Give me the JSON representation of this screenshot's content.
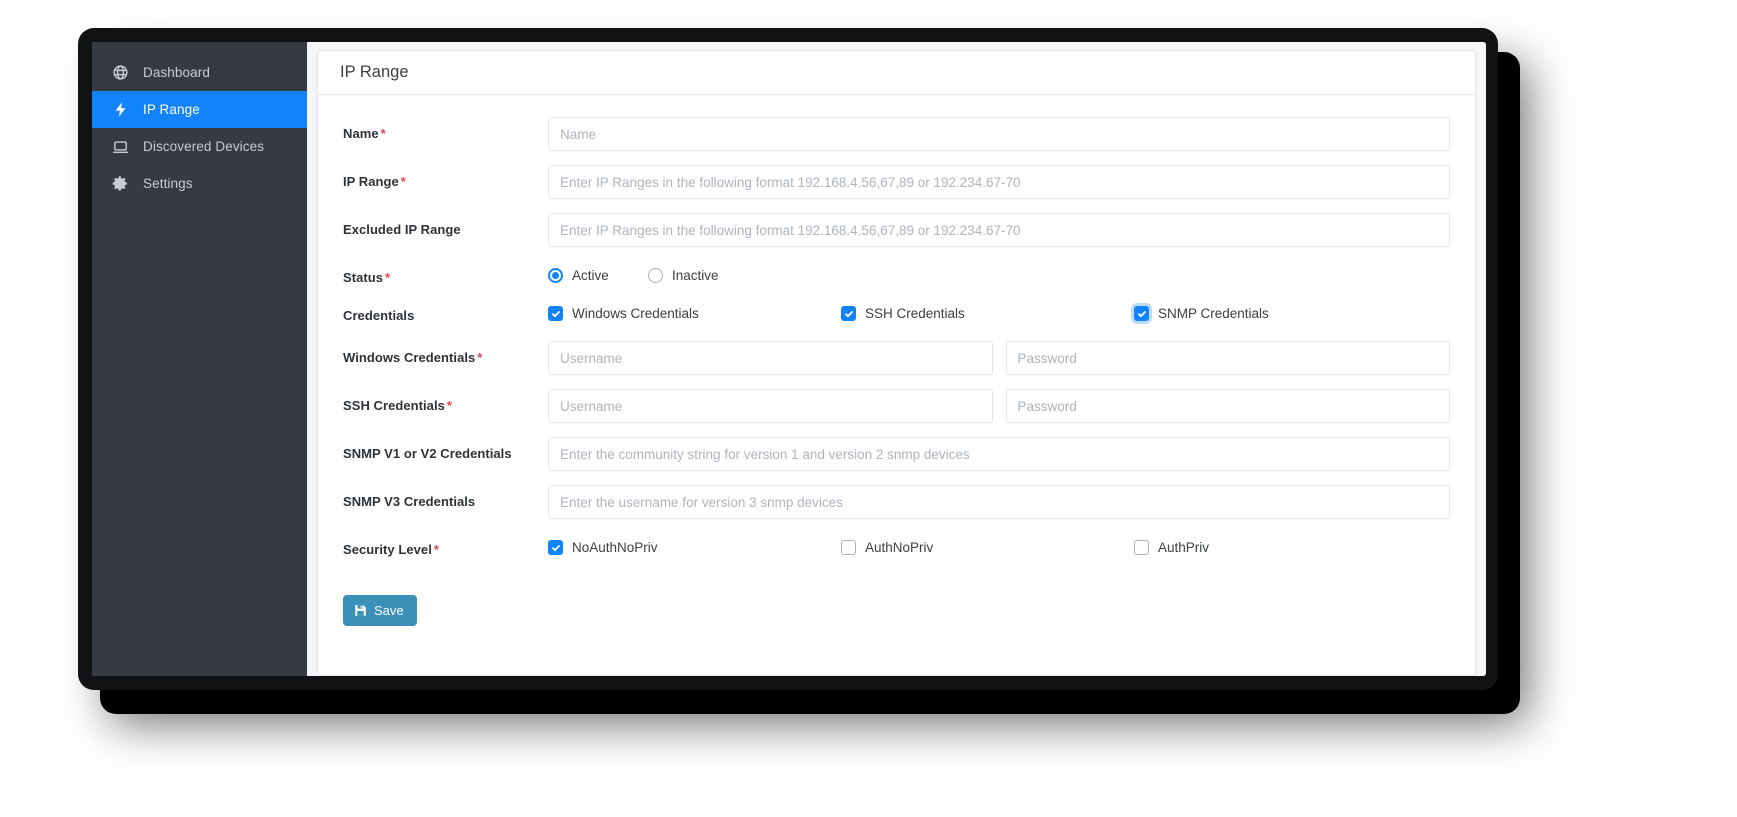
{
  "app": {
    "sidebar": {
      "items": [
        {
          "label": "Dashboard",
          "icon": "globe-icon",
          "active": false
        },
        {
          "label": "IP Range",
          "icon": "lightning-bolt-icon",
          "active": true
        },
        {
          "label": "Discovered Devices",
          "icon": "laptop-icon",
          "active": false
        },
        {
          "label": "Settings",
          "icon": "gear-icon",
          "active": false
        }
      ]
    },
    "card": {
      "title": "IP Range"
    },
    "form": {
      "name": {
        "label": "Name",
        "required": true,
        "value": "",
        "placeholder": "Name"
      },
      "ip_range": {
        "label": "IP Range",
        "required": true,
        "value": "",
        "placeholder": "Enter IP Ranges in the following format 192.168.4.56,67,89 or 192.234.67-70"
      },
      "excluded_ip_range": {
        "label": "Excluded IP Range",
        "required": false,
        "value": "",
        "placeholder": "Enter IP Ranges in the following format 192.168.4.56,67,89 or 192.234.67-70"
      },
      "status": {
        "label": "Status",
        "required": true,
        "options": [
          {
            "label": "Active",
            "selected": true
          },
          {
            "label": "Inactive",
            "selected": false
          }
        ]
      },
      "credentials": {
        "label": "Credentials",
        "required": false,
        "options": [
          {
            "label": "Windows Credentials",
            "checked": true,
            "focused": false
          },
          {
            "label": "SSH Credentials",
            "checked": true,
            "focused": false
          },
          {
            "label": "SNMP Credentials",
            "checked": true,
            "focused": true
          }
        ]
      },
      "windows_credentials": {
        "label": "Windows Credentials",
        "required": true,
        "username": {
          "value": "",
          "placeholder": "Username"
        },
        "password": {
          "value": "",
          "placeholder": "Password"
        }
      },
      "ssh_credentials": {
        "label": "SSH Credentials",
        "required": true,
        "username": {
          "value": "",
          "placeholder": "Username"
        },
        "password": {
          "value": "",
          "placeholder": "Password"
        }
      },
      "snmp_v1_v2": {
        "label": "SNMP V1 or V2 Credentials",
        "required": false,
        "value": "",
        "placeholder": "Enter the community string for version 1 and version 2 snmp devices"
      },
      "snmp_v3": {
        "label": "SNMP V3 Credentials",
        "required": false,
        "value": "",
        "placeholder": "Enter the username for version 3 snmp devices"
      },
      "security_level": {
        "label": "Security Level",
        "required": true,
        "options": [
          {
            "label": "NoAuthNoPriv",
            "checked": true
          },
          {
            "label": "AuthNoPriv",
            "checked": false
          },
          {
            "label": "AuthPriv",
            "checked": false
          }
        ]
      },
      "save_button": {
        "label": "Save",
        "icon": "save-floppy-icon"
      }
    },
    "colors": {
      "sidebar_bg": "#353b41",
      "accent_blue": "#1283fa",
      "save_button": "#3b8fb8",
      "required_star": "#e0425a",
      "content_bg": "#f4f6f7"
    }
  }
}
